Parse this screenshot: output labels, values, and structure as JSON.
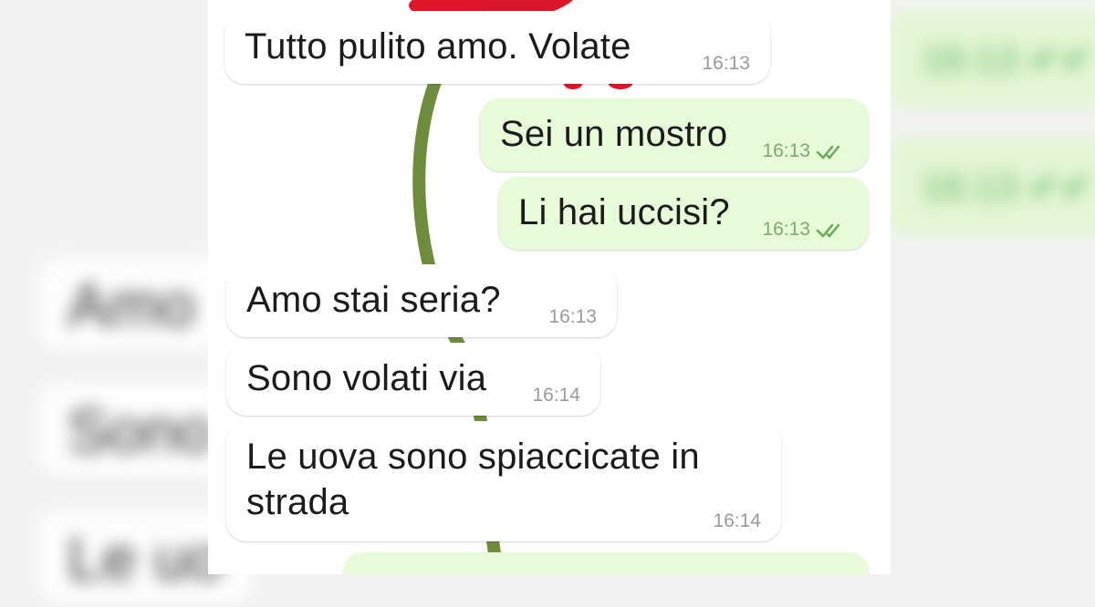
{
  "side": {
    "left_fragments": [
      "Amo",
      "Sono",
      "Le uo"
    ],
    "right_times": [
      "16:13",
      "16:13"
    ]
  },
  "messages": [
    {
      "direction": "in",
      "text": "Tutto pulito amo. Volate",
      "time": "16:13"
    },
    {
      "direction": "out",
      "text": "Sei un mostro",
      "time": "16:13",
      "status": "double-check-read"
    },
    {
      "direction": "out",
      "text": "Li hai uccisi?",
      "time": "16:13",
      "status": "double-check-read"
    },
    {
      "direction": "in",
      "text": "Amo stai seria?",
      "time": "16:13"
    },
    {
      "direction": "in",
      "text": "Sono volati via",
      "time": "16:14"
    },
    {
      "direction": "in",
      "text": "Le uova sono spiaccicate in strada",
      "time": "16:14"
    }
  ],
  "colors": {
    "incoming_bubble": "#ffffff",
    "outgoing_bubble": "#e7fbd8",
    "read_check": "#6aa85e",
    "flower": "#e2162b",
    "stem": "#6e8d3c"
  },
  "icons": {
    "read_status": "double-check-icon",
    "decoration": "red-flower-icon"
  }
}
